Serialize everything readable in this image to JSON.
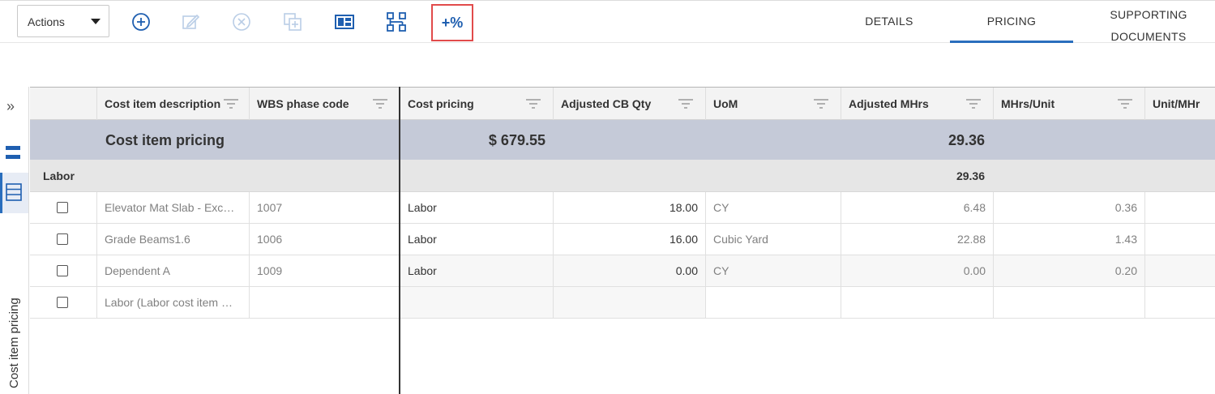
{
  "toolbar": {
    "actions_label": "Actions",
    "percent_label": "+%",
    "icons": [
      "add-circle-icon",
      "edit-icon",
      "cancel-circle-icon",
      "copy-icon",
      "layout-panel-icon",
      "hierarchy-icon"
    ]
  },
  "tabs": {
    "details": "DETAILS",
    "pricing": "PRICING",
    "supporting_line1": "SUPPORTING",
    "supporting_line2": "DOCUMENTS"
  },
  "rail": {
    "vertical_label": "Cost item pricing"
  },
  "grid": {
    "headers": {
      "desc": "Cost item description",
      "wbs": "WBS phase code",
      "cost": "Cost pricing",
      "qty": "Adjusted CB Qty",
      "uom": "UoM",
      "mhrs": "Adjusted MHrs",
      "mhrs_unit": "MHrs/Unit",
      "unit_mhr": "Unit/MHr"
    },
    "summary": {
      "title": "Cost item pricing",
      "cost": "$ 679.55",
      "mhrs": "29.36"
    },
    "group": {
      "title": "Labor",
      "mhrs": "29.36"
    },
    "rows": [
      {
        "desc": "Elevator Mat Slab - Exc…",
        "wbs": "1007",
        "cost": "Labor",
        "qty": "18.00",
        "uom": "CY",
        "mhrs": "6.48",
        "mhrs_unit": "0.36"
      },
      {
        "desc": "Grade Beams1.6",
        "wbs": "1006",
        "cost": "Labor",
        "qty": "16.00",
        "uom": "Cubic Yard",
        "mhrs": "22.88",
        "mhrs_unit": "1.43"
      },
      {
        "desc": "Dependent A",
        "wbs": "1009",
        "cost": "Labor",
        "qty": "0.00",
        "uom": "CY",
        "mhrs": "0.00",
        "mhrs_unit": "0.20"
      },
      {
        "desc": "Labor (Labor cost item …",
        "wbs": "",
        "cost": "",
        "qty": "",
        "uom": "",
        "mhrs": "",
        "mhrs_unit": ""
      }
    ]
  }
}
